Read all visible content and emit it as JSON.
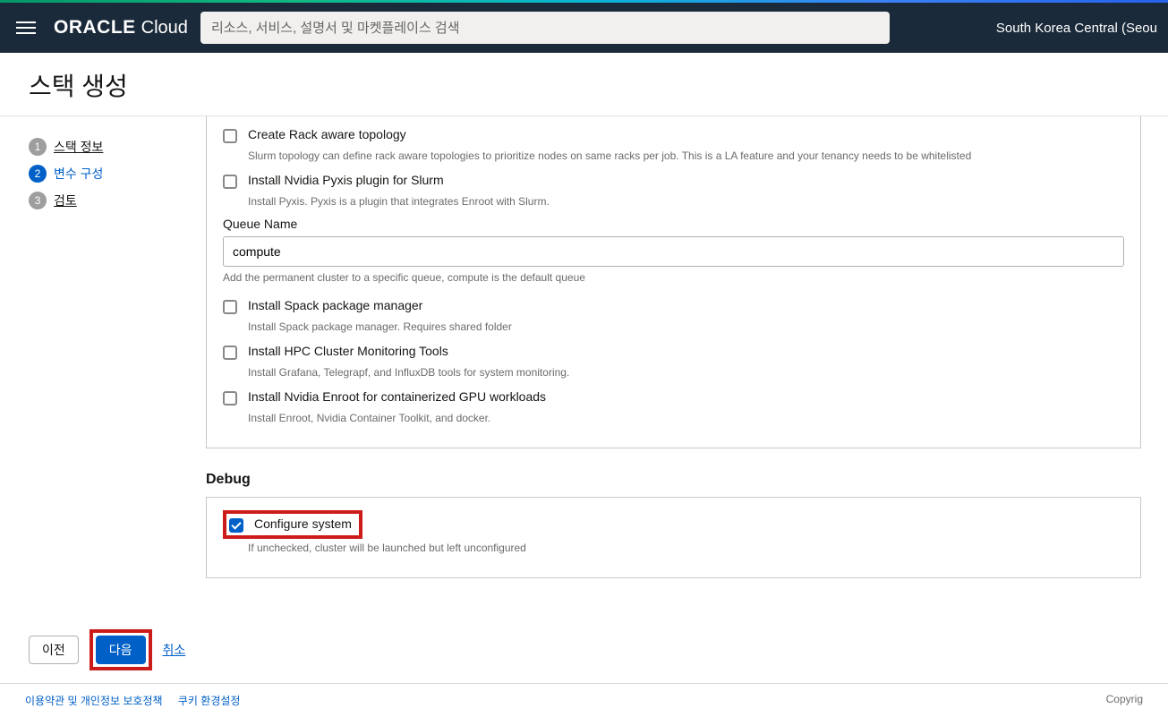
{
  "header": {
    "logo_brand": "ORACLE",
    "logo_product": "Cloud",
    "search_placeholder": "리소스, 서비스, 설명서 및 마켓플레이스 검색",
    "region": "South Korea Central (Seou"
  },
  "page": {
    "title": "스택 생성"
  },
  "sidebar": {
    "steps": [
      {
        "num": "1",
        "label": "스택 정보",
        "active": false
      },
      {
        "num": "2",
        "label": "변수 구성",
        "active": true
      },
      {
        "num": "3",
        "label": "검토",
        "active": false
      }
    ]
  },
  "form": {
    "rack_topology": {
      "label": "Create Rack aware topology",
      "desc": "Slurm topology can define rack aware topologies to prioritize nodes on same racks per job. This is a LA feature and your tenancy needs to be whitelisted"
    },
    "pyxis": {
      "label": "Install Nvidia Pyxis plugin for Slurm",
      "desc": "Install Pyxis. Pyxis is a plugin that integrates Enroot with Slurm."
    },
    "queue_name": {
      "label": "Queue Name",
      "value": "compute",
      "help": "Add the permanent cluster to a specific queue, compute is the default queue"
    },
    "spack": {
      "label": "Install Spack package manager",
      "desc": "Install Spack package manager. Requires shared folder"
    },
    "monitoring": {
      "label": "Install HPC Cluster Monitoring Tools",
      "desc": "Install Grafana, Telegrapf, and InfluxDB tools for system monitoring."
    },
    "enroot": {
      "label": "Install Nvidia Enroot for containerized GPU workloads",
      "desc": "Install Enroot, Nvidia Container Toolkit, and docker."
    }
  },
  "debug": {
    "section_title": "Debug",
    "configure_system": {
      "label": "Configure system",
      "desc": "If unchecked, cluster will be launched but left unconfigured"
    }
  },
  "buttons": {
    "prev": "이전",
    "next": "다음",
    "cancel": "취소"
  },
  "footer": {
    "terms": "이용약관 및 개인정보 보호정책",
    "cookies": "쿠키 환경설정",
    "copyright": "Copyrig"
  }
}
